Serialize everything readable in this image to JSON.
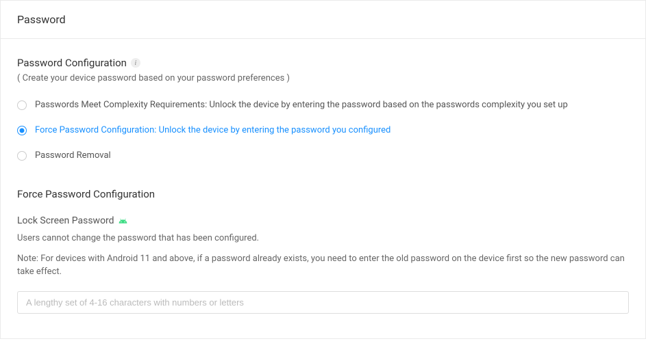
{
  "header": {
    "title": "Password"
  },
  "config": {
    "section_title": "Password Configuration",
    "section_subtitle": "( Create your device password based on your password preferences )",
    "options": [
      {
        "label": "Passwords Meet Complexity Requirements: Unlock the device by entering the password based on the passwords complexity you set up",
        "selected": false
      },
      {
        "label": "Force Password Configuration: Unlock the device by entering the password you configured",
        "selected": true
      },
      {
        "label": "Password Removal",
        "selected": false
      }
    ]
  },
  "force": {
    "title": "Force Password Configuration",
    "lock_label": "Lock Screen Password",
    "desc": "Users cannot change the password that has been configured.",
    "note": "Note: For devices with Android 11 and above, if a password already exists, you need to enter the old password on the device first so the new password can take effect.",
    "placeholder": "A lengthy set of 4-16 characters with numbers or letters"
  }
}
